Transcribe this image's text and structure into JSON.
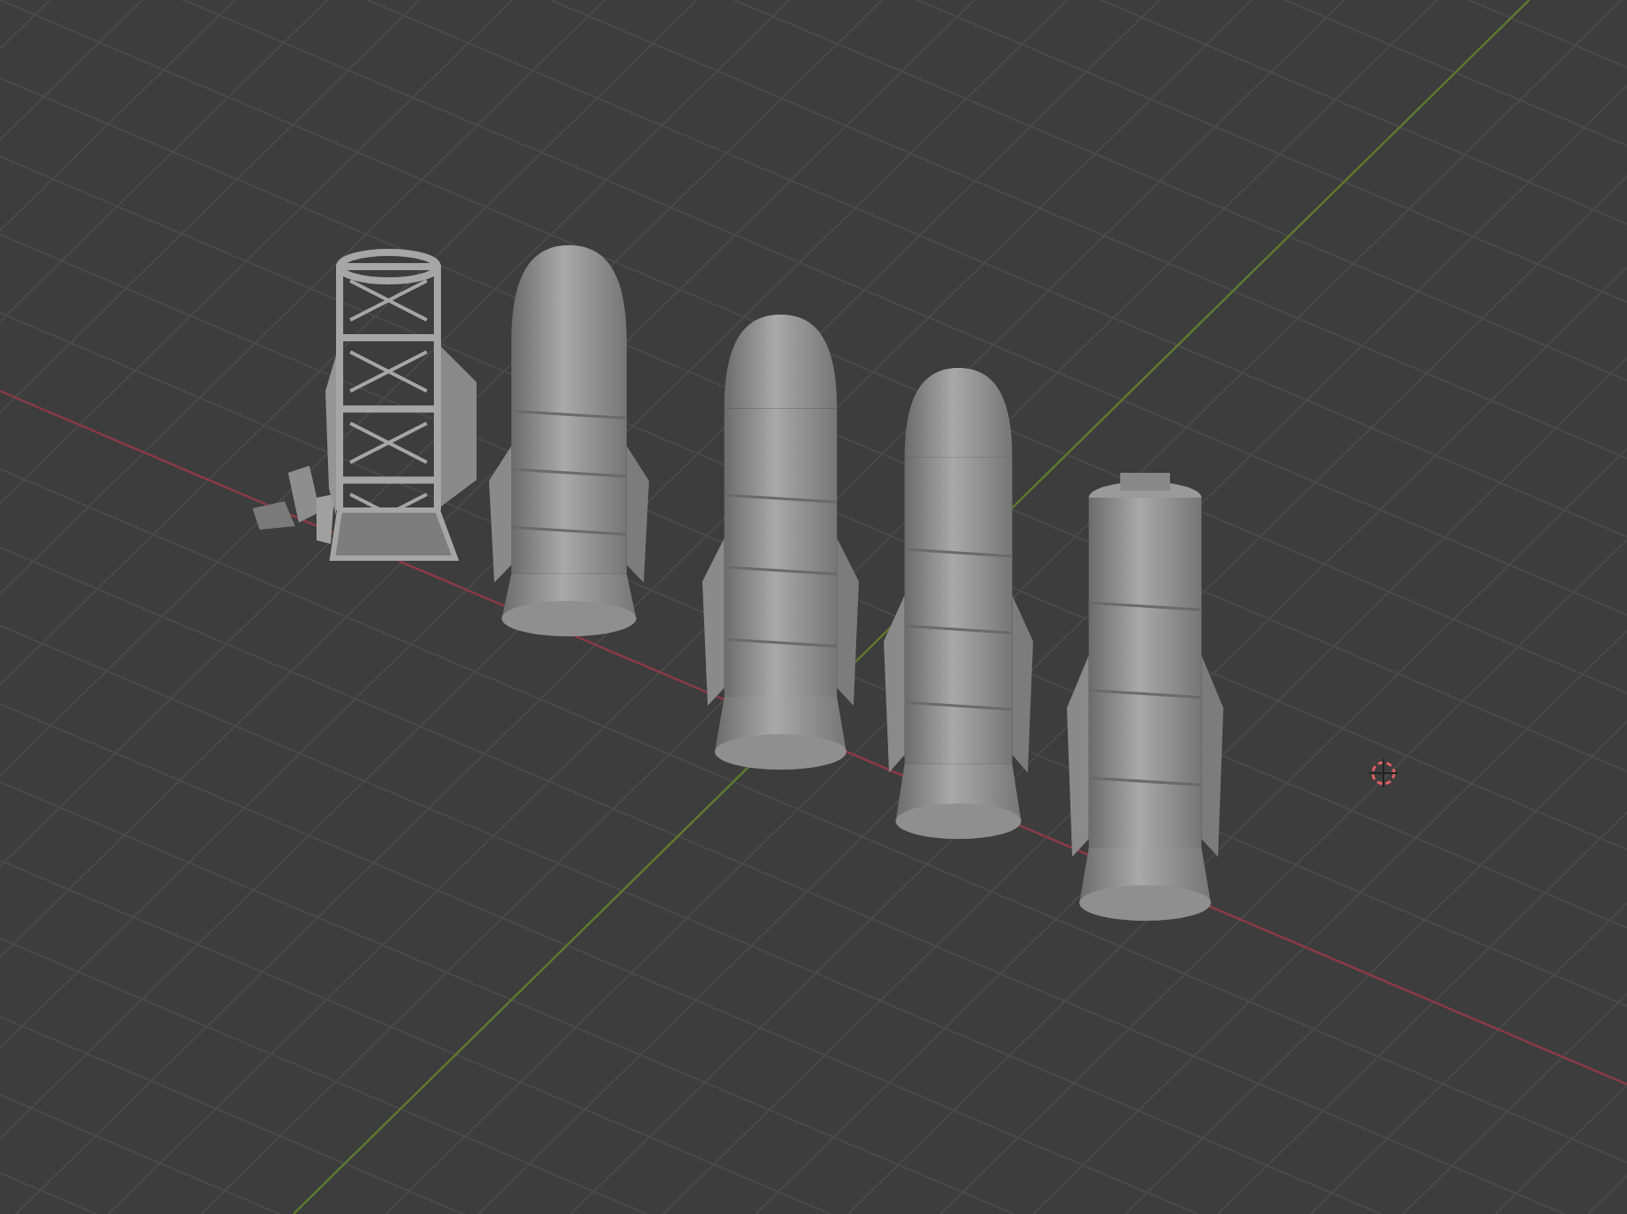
{
  "viewport": {
    "objects": [
      {
        "kind": "debris"
      },
      {
        "kind": "frame"
      },
      {
        "kind": "rocket"
      },
      {
        "kind": "rocket"
      },
      {
        "kind": "rocket"
      },
      {
        "kind": "open-rocket"
      }
    ]
  }
}
